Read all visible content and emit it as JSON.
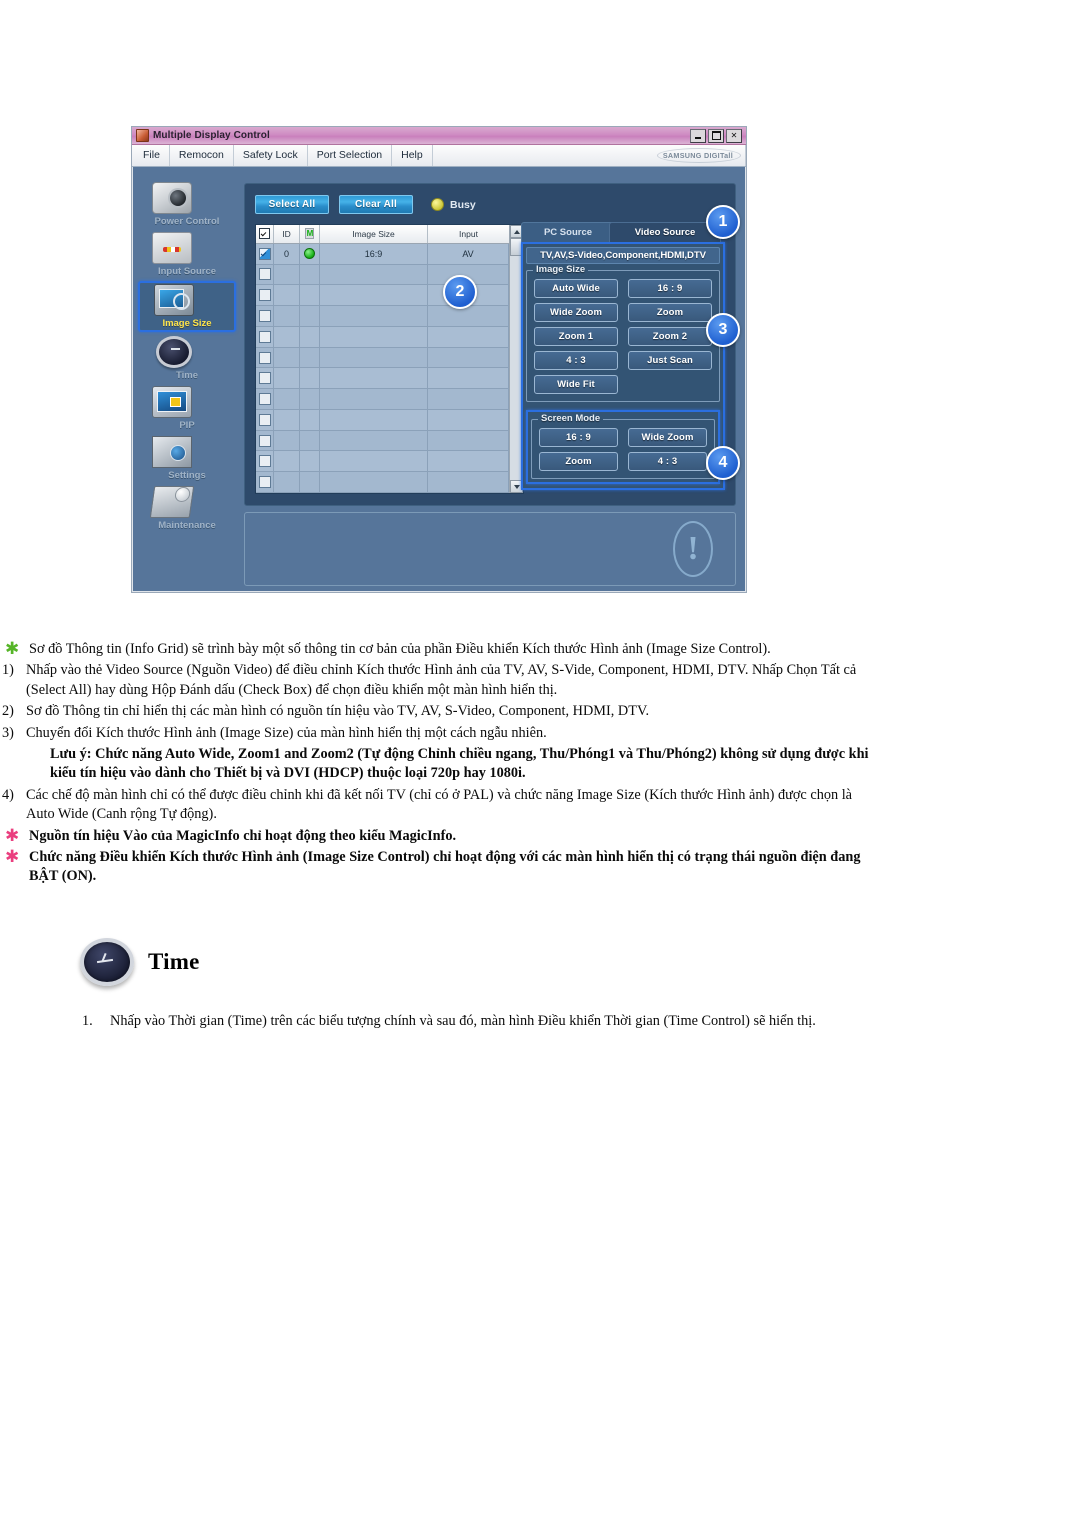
{
  "app": {
    "title": "Multiple Display Control",
    "brand": "SAMSUNG DIGITall",
    "window_buttons": [
      "minimize",
      "maximize",
      "close"
    ],
    "menu": [
      "File",
      "Remocon",
      "Safety Lock",
      "Port Selection",
      "Help"
    ],
    "toolbar": {
      "select_all": "Select All",
      "clear_all": "Clear All",
      "status_label": "Busy"
    },
    "sidebar": [
      {
        "label": "Power Control",
        "icon": "power-control-icon",
        "selected": false
      },
      {
        "label": "Input Source",
        "icon": "input-source-icon",
        "selected": false
      },
      {
        "label": "Image Size",
        "icon": "image-size-icon",
        "selected": true
      },
      {
        "label": "Time",
        "icon": "time-icon",
        "selected": false
      },
      {
        "label": "PIP",
        "icon": "pip-icon",
        "selected": false
      },
      {
        "label": "Settings",
        "icon": "settings-icon",
        "selected": false
      },
      {
        "label": "Maintenance",
        "icon": "maintenance-icon",
        "selected": false
      }
    ],
    "grid": {
      "columns": [
        "",
        "ID",
        "M",
        "Image Size",
        "Input"
      ],
      "rows": [
        {
          "checked": true,
          "id": "0",
          "power": "on",
          "image_size": "16:9",
          "input": "AV"
        },
        {
          "checked": false,
          "id": "",
          "power": "",
          "image_size": "",
          "input": ""
        },
        {
          "checked": false,
          "id": "",
          "power": "",
          "image_size": "",
          "input": ""
        },
        {
          "checked": false,
          "id": "",
          "power": "",
          "image_size": "",
          "input": ""
        },
        {
          "checked": false,
          "id": "",
          "power": "",
          "image_size": "",
          "input": ""
        },
        {
          "checked": false,
          "id": "",
          "power": "",
          "image_size": "",
          "input": ""
        },
        {
          "checked": false,
          "id": "",
          "power": "",
          "image_size": "",
          "input": ""
        },
        {
          "checked": false,
          "id": "",
          "power": "",
          "image_size": "",
          "input": ""
        },
        {
          "checked": false,
          "id": "",
          "power": "",
          "image_size": "",
          "input": ""
        },
        {
          "checked": false,
          "id": "",
          "power": "",
          "image_size": "",
          "input": ""
        },
        {
          "checked": false,
          "id": "",
          "power": "",
          "image_size": "",
          "input": ""
        },
        {
          "checked": false,
          "id": "",
          "power": "",
          "image_size": "",
          "input": ""
        }
      ]
    },
    "tabs": [
      {
        "label": "PC Source",
        "active": false
      },
      {
        "label": "Video Source",
        "active": true
      }
    ],
    "source_bar": "TV,AV,S-Video,Component,HDMI,DTV",
    "image_size": {
      "legend": "Image Size",
      "buttons": [
        "Auto Wide",
        "16 : 9",
        "Wide Zoom",
        "Zoom",
        "Zoom 1",
        "Zoom 2",
        "4 : 3",
        "Just Scan",
        "Wide Fit"
      ]
    },
    "screen_mode": {
      "legend": "Screen Mode",
      "buttons": [
        "16 : 9",
        "Wide Zoom",
        "Zoom",
        "4 : 3"
      ]
    },
    "callouts": [
      "1",
      "2",
      "3",
      "4"
    ],
    "colors": {
      "window_bg": "#56759a",
      "panel_bg": "#2e4a6b",
      "accent_blue": "#2b6fe0",
      "titlebar": "#cf8cc3",
      "selected_label": "#ffe54a",
      "busy": "#d9d24a"
    }
  },
  "doc": {
    "items": [
      {
        "marker": "star-green",
        "text": "Sơ đồ Thông tin (Info Grid) sẽ trình bày một số thông tin cơ bản của phần Điều khiển Kích thước Hình ảnh (Image Size Control)."
      },
      {
        "marker": "1)",
        "text": "Nhấp vào thẻ Video Source (Nguồn Video) để điều chỉnh Kích thước Hình ảnh của TV, AV, S-Vide, Component, HDMI, DTV. Nhấp Chọn Tất cả (Select All) hay dùng Hộp Đánh dấu (Check Box) để chọn điều khiển một màn hình hiển thị."
      },
      {
        "marker": "2)",
        "text": "Sơ đồ Thông tin chỉ hiển thị các màn hình có nguồn tín hiệu vào TV, AV, S-Video, Component, HDMI, DTV."
      },
      {
        "marker": "3)",
        "text": "Chuyển đổi Kích thước Hình ảnh (Image Size) của màn hình hiển thị một cách ngẫu nhiên."
      },
      {
        "marker": "note",
        "text": "Lưu ý: Chức năng Auto Wide, Zoom1 and Zoom2 (Tự động Chỉnh chiều ngang, Thu/Phóng1 và Thu/Phóng2) không sử dụng được khi kiểu tín hiệu vào dành cho Thiết bị và DVI (HDCP) thuộc loại 720p hay 1080i."
      },
      {
        "marker": "4)",
        "text": "Các chế độ màn hình chỉ có thể được điều chỉnh khi đã kết nối TV (chỉ có ở PAL) và chức năng Image Size (Kích thước Hình ảnh) được chọn là Auto Wide (Canh rộng Tự động)."
      },
      {
        "marker": "star-pink",
        "text": "Nguồn tín hiệu Vào của MagicInfo chỉ hoạt động theo kiểu MagicInfo."
      },
      {
        "marker": "star-pink",
        "text": "Chức năng Điều khiển Kích thước Hình ảnh (Image Size Control) chỉ hoạt động với các màn hình hiển thị có trạng thái nguồn điện đang BẬT (ON)."
      }
    ],
    "time_section": {
      "heading": "Time",
      "step_number": "1.",
      "step_text": "Nhấp vào Thời gian (Time) trên các biểu tượng chính và sau đó, màn hình Điều khiển Thời gian (Time Control) sẽ hiển thị."
    }
  }
}
